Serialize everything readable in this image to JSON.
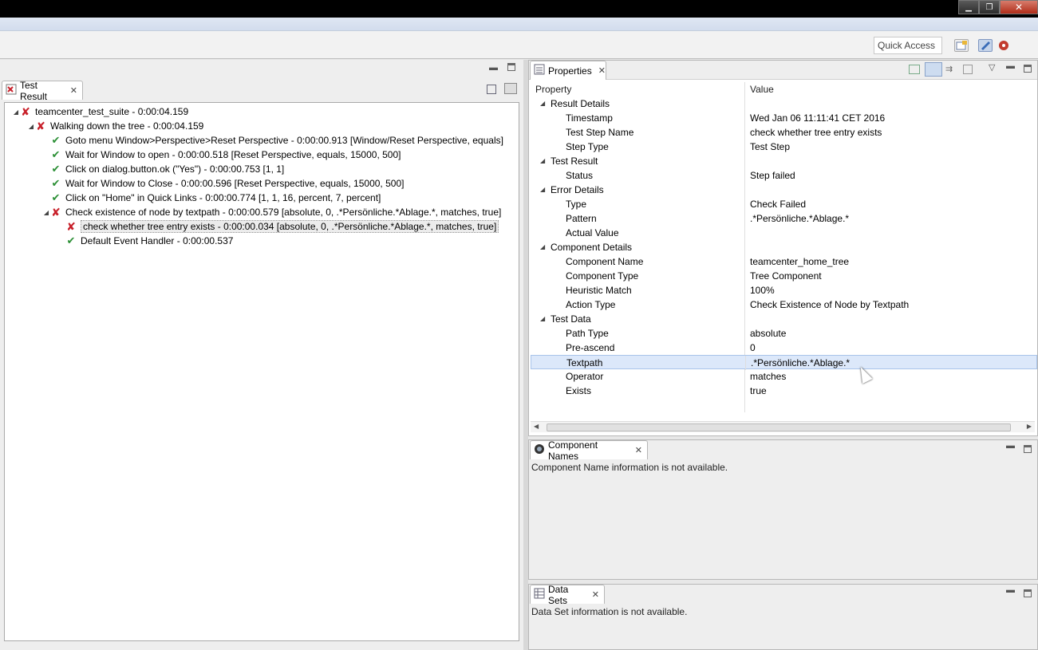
{
  "window": {
    "minimize_glyph": "▁",
    "restore_glyph": "❐",
    "close_glyph": "✕"
  },
  "toolbar": {
    "quick_access_placeholder": "Quick Access",
    "icons": [
      "open-perspective-icon",
      "spec-perspective-icon",
      "execution-perspective-icon"
    ]
  },
  "test_result_view": {
    "tab_label": "Test Result",
    "tree": [
      {
        "depth": 0,
        "status": "fail",
        "expanded": true,
        "label": "teamcenter_test_suite - 0:00:04.159"
      },
      {
        "depth": 1,
        "status": "fail",
        "expanded": true,
        "label": "Walking down the tree - 0:00:04.159"
      },
      {
        "depth": 2,
        "status": "ok",
        "expanded": null,
        "label": "Goto menu Window>Perspective>Reset Perspective - 0:00:00.913 [Window/Reset Perspective, equals]"
      },
      {
        "depth": 2,
        "status": "ok",
        "expanded": null,
        "label": "Wait for Window to open - 0:00:00.518 [Reset Perspective, equals, 15000, 500]"
      },
      {
        "depth": 2,
        "status": "ok",
        "expanded": null,
        "label": "Click on dialog.button.ok (\"Yes\") - 0:00:00.753 [1, 1]"
      },
      {
        "depth": 2,
        "status": "ok",
        "expanded": null,
        "label": "Wait for Window to Close - 0:00:00.596 [Reset Perspective, equals, 15000, 500]"
      },
      {
        "depth": 2,
        "status": "ok",
        "expanded": null,
        "label": "Click on \"Home\" in Quick Links - 0:00:00.774 [1, 1, 16, percent, 7, percent]"
      },
      {
        "depth": 2,
        "status": "fail",
        "expanded": true,
        "label": "Check existence of node by textpath - 0:00:00.579 [absolute, 0, .*Persönliche.*Ablage.*, matches, true]"
      },
      {
        "depth": 3,
        "status": "fail",
        "expanded": null,
        "selected": true,
        "label": "check whether tree entry exists - 0:00:00.034 [absolute, 0, .*Persönliche.*Ablage.*, matches, true]"
      },
      {
        "depth": 3,
        "status": "ok",
        "expanded": null,
        "label": "Default Event Handler - 0:00:00.537"
      }
    ]
  },
  "properties_view": {
    "tab_label": "Properties",
    "columns": {
      "property": "Property",
      "value": "Value"
    },
    "rows": [
      {
        "group": true,
        "property": "Result Details",
        "value": ""
      },
      {
        "group": false,
        "property": "Timestamp",
        "value": "Wed Jan 06 11:11:41 CET 2016"
      },
      {
        "group": false,
        "property": "Test Step Name",
        "value": "check whether tree entry exists"
      },
      {
        "group": false,
        "property": "Step Type",
        "value": "Test Step"
      },
      {
        "group": true,
        "property": "Test Result",
        "value": ""
      },
      {
        "group": false,
        "property": "Status",
        "value": "Step failed"
      },
      {
        "group": true,
        "property": "Error Details",
        "value": ""
      },
      {
        "group": false,
        "property": "Type",
        "value": "Check Failed"
      },
      {
        "group": false,
        "property": "Pattern",
        "value": ".*Persönliche.*Ablage.*"
      },
      {
        "group": false,
        "property": "Actual Value",
        "value": ""
      },
      {
        "group": true,
        "property": "Component Details",
        "value": ""
      },
      {
        "group": false,
        "property": "Component Name",
        "value": "teamcenter_home_tree"
      },
      {
        "group": false,
        "property": "Component Type",
        "value": "Tree Component"
      },
      {
        "group": false,
        "property": "Heuristic Match",
        "value": "100%"
      },
      {
        "group": false,
        "property": "Action Type",
        "value": "Check Existence of Node by Textpath"
      },
      {
        "group": true,
        "property": "Test Data",
        "value": ""
      },
      {
        "group": false,
        "property": "Path Type",
        "value": "absolute"
      },
      {
        "group": false,
        "property": "Pre-ascend",
        "value": "0"
      },
      {
        "group": false,
        "property": "Textpath",
        "value": ".*Persönliche.*Ablage.*",
        "selected": true
      },
      {
        "group": false,
        "property": "Operator",
        "value": "matches"
      },
      {
        "group": false,
        "property": "Exists",
        "value": "true"
      }
    ]
  },
  "component_names_view": {
    "tab_label": "Component Names",
    "message": "Component Name information is not available."
  },
  "data_sets_view": {
    "tab_label": "Data Sets",
    "message": "Data Set information is not available."
  },
  "colors": {
    "fail": "#c8202a",
    "ok": "#2b8f35",
    "selection": "#dce8fa"
  }
}
